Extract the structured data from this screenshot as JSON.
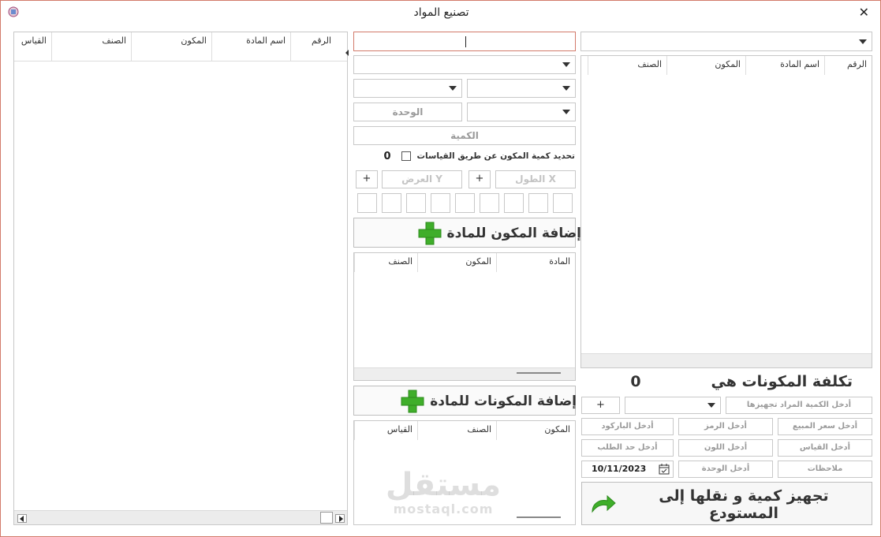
{
  "window": {
    "title": "تصنيع المواد",
    "close": "✕"
  },
  "top_right": {
    "grid_headers": [
      "الرقم",
      "اسم المادة",
      "المكون",
      "الصنف"
    ]
  },
  "middle": {
    "unit_placeholder": "الوحدة",
    "quantity_placeholder": "الكمية",
    "measure_checkbox_label": "تحديد كمية المكون عن طريق القياسات",
    "measure_value": "0",
    "length_placeholder": "الطول X",
    "width_placeholder": "العرض Y",
    "plus": "+",
    "add_component_button": "إضافة المكون للمادة",
    "components_grid_headers": [
      "المادة",
      "المكون",
      "الصنف"
    ],
    "add_components_button": "إضافة المكونات للمادة",
    "bottom_grid_headers": [
      "المكون",
      "الصنف",
      "القياس"
    ]
  },
  "left": {
    "grid_headers": [
      "الرقم",
      "اسم المادة",
      "المكون",
      "الصنف",
      "القياس"
    ]
  },
  "bottom_right": {
    "cost_label": "تكلفة المكونات هي",
    "cost_value": "0",
    "prepare_qty_placeholder": "أدخل الكمية المراد تجهيزها",
    "plus": "+",
    "sale_price": "أدخل سعر المبيع",
    "symbol": "أدخل الرمز",
    "barcode": "أدخل الباركود",
    "measure": "أدخل القياس",
    "color": "أدخل اللون",
    "order_limit": "أدخل حد الطلب",
    "notes": "ملاحظات",
    "unit": "أدخل الوحدة",
    "date": "10/11/2023",
    "prepare_button": "تجهيز كمية و نقلها إلى المستودع"
  },
  "watermark": {
    "arabic": "مستقل",
    "latin": "mostaql.com"
  },
  "colors": {
    "frame_border": "#d27a6a",
    "accent_green": "#3fae2a",
    "input_focus_border": "#d27a6a"
  }
}
